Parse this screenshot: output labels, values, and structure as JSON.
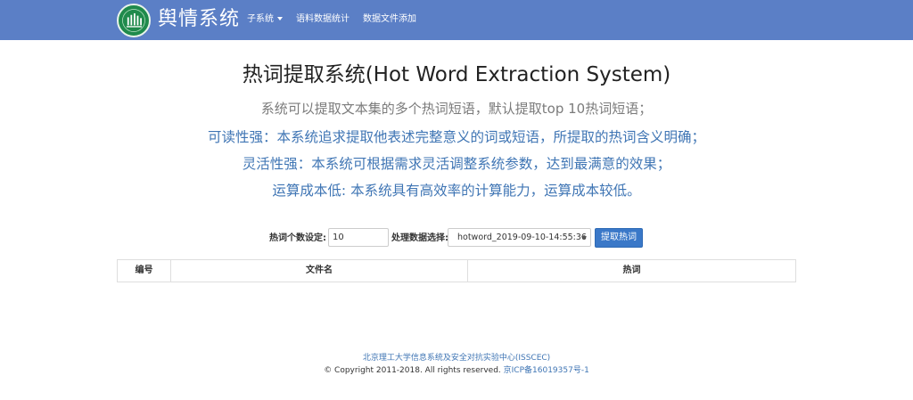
{
  "navbar": {
    "brand": "舆情系统",
    "items": [
      {
        "label": "子系统"
      },
      {
        "label": "语料数据统计"
      },
      {
        "label": "数据文件添加"
      }
    ],
    "color": "#5b7fc6"
  },
  "main": {
    "title": "热词提取系统(Hot Word Extraction System)",
    "description": "系统可以提取文本集的多个热词短语，默认提取top 10热词短语；",
    "features": [
      "可读性强：本系统追求提取他表述完整意义的词或短语，所提取的热词含义明确；",
      "灵活性强：本系统可根据需求灵活调整系统参数，达到最满意的效果；",
      "运算成本低: 本系统具有高效率的计算能力，运算成本较低。"
    ]
  },
  "form": {
    "count_label": "热词个数设定:",
    "count_value": "10",
    "data_label": "处理数据选择:",
    "data_selected": "hotword_2019-09-10-14:55:36",
    "submit_label": "提取热词",
    "button_color": "#3a78c8"
  },
  "table": {
    "headers": [
      "编号",
      "文件名",
      "热词"
    ]
  },
  "footer": {
    "org": "北京理工大学信息系统及安全对抗实验中心(ISSCEC)",
    "copyright": "© Copyright 2011-2018. All rights reserved.",
    "icp": "京ICP备16019357号-1"
  },
  "icons": {
    "logo": "logo-icon"
  }
}
